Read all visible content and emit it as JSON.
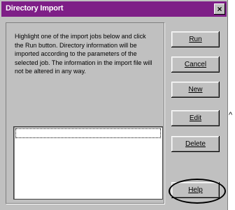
{
  "dialog": {
    "title": "Directory Import",
    "close_glyph": "×"
  },
  "description": "Highlight one of the import jobs below and click the Run button. Directory information will be imported according to the parameters of the selected job. The information in the import file will not be altered in any way.",
  "import_jobs": [],
  "buttons": {
    "run": "Run",
    "cancel": "Cancel",
    "new": "New",
    "edit": "Edit",
    "delete": "Delete",
    "help": "Help"
  },
  "arrow_glyph": "^",
  "colors": {
    "titlebar": "#7e1f87",
    "dialog_bg": "#c0c0c0",
    "list_bg": "#ffffff"
  }
}
